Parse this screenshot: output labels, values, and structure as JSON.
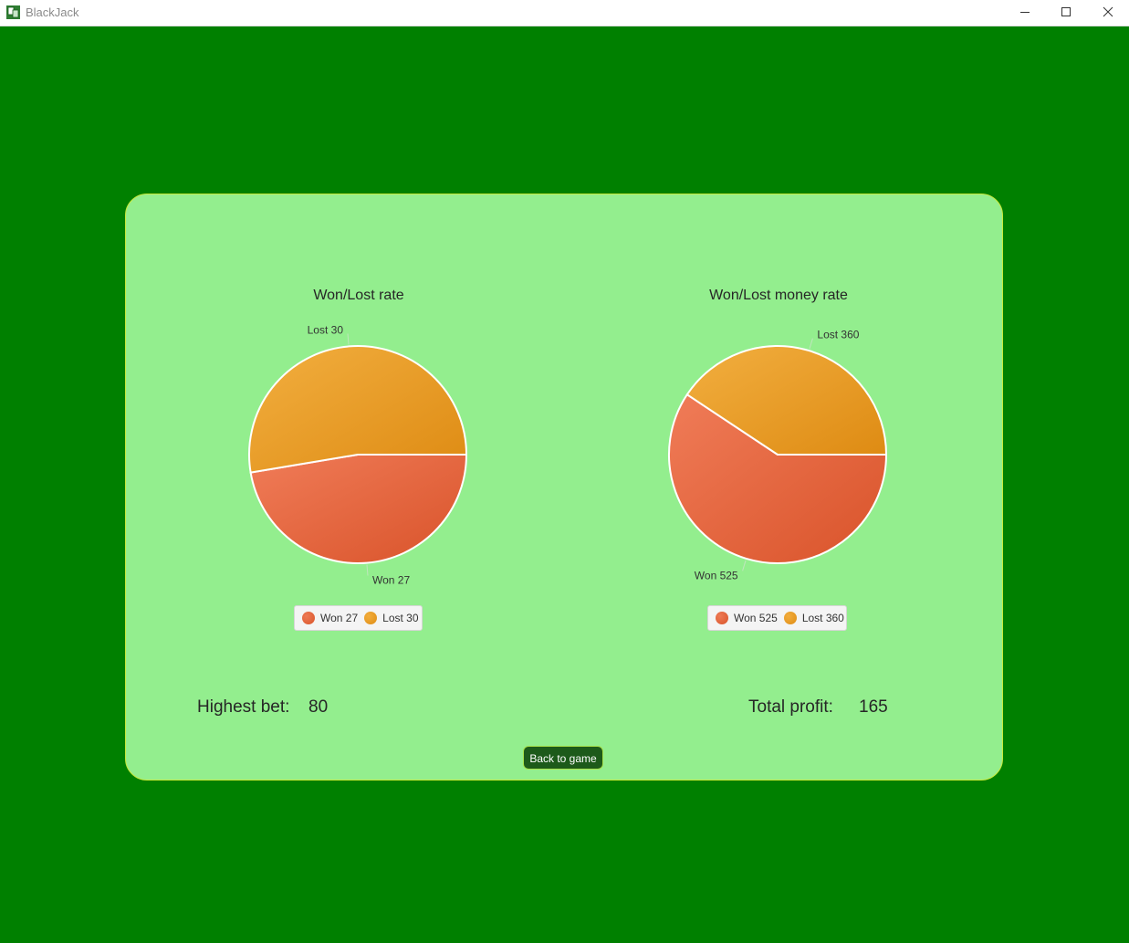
{
  "window": {
    "title": "BlackJack",
    "controls": [
      "minimize-icon",
      "maximize-icon",
      "close-icon"
    ]
  },
  "charts": [
    {
      "title": "Won/Lost rate",
      "legend": [
        "Won 27",
        "Lost 30"
      ]
    },
    {
      "title": "Won/Lost money rate",
      "legend": [
        "Won 525",
        "Lost 360"
      ]
    }
  ],
  "chart_data": [
    {
      "type": "pie",
      "title": "Won/Lost rate",
      "slices": [
        {
          "label": "Won",
          "value": 27,
          "color": "#e0622f"
        },
        {
          "label": "Lost",
          "value": 30,
          "color": "#eea12a"
        }
      ],
      "slice_labels": [
        "Won 27",
        "Lost 30"
      ],
      "legend": "bottom"
    },
    {
      "type": "pie",
      "title": "Won/Lost money rate",
      "slices": [
        {
          "label": "Won",
          "value": 525,
          "color": "#e0622f"
        },
        {
          "label": "Lost",
          "value": 360,
          "color": "#eea12a"
        }
      ],
      "slice_labels": [
        "Won 525",
        "Lost 360"
      ],
      "legend": "bottom"
    }
  ],
  "stats": {
    "highest_bet_label": "Highest bet:",
    "highest_bet_value": "80",
    "total_profit_label": "Total profit:",
    "total_profit_value": "165"
  },
  "back_button_label": "Back to game",
  "colors": {
    "background": "#008000",
    "panel": "#93ee8e",
    "panel_border": "#c8e83a",
    "won": "#e0622f",
    "lost": "#eea12a",
    "button": "#1d5a1a"
  }
}
